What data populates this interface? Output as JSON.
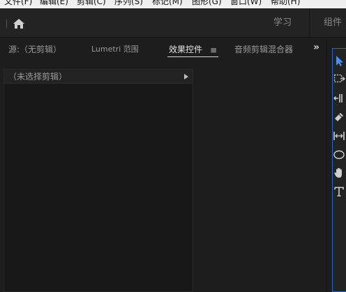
{
  "menu": {
    "items": [
      "文件(F)",
      "编辑(E)",
      "剪辑(C)",
      "序列(S)",
      "标记(M)",
      "图形(G)",
      "窗口(W)",
      "帮助(H)"
    ]
  },
  "header": {
    "home_icon": "home-icon",
    "workspaces": {
      "learn": "学习",
      "assembly": "组件"
    }
  },
  "panels": {
    "tabs": [
      {
        "label": "源:（无剪辑）",
        "active": false
      },
      {
        "label": "Lumetri 范围",
        "active": false
      },
      {
        "label": "效果控件",
        "active": true
      },
      {
        "label": "音频剪辑混合器",
        "active": false
      }
    ],
    "tab_menu_glyph": "≡",
    "overflow_glyph": "»"
  },
  "effect_controls": {
    "header_text": "（未选择剪辑）"
  },
  "tools": [
    {
      "name": "selection-tool-icon",
      "active": true
    },
    {
      "name": "track-select-tool-icon",
      "active": false
    },
    {
      "name": "ripple-edit-tool-icon",
      "active": false
    },
    {
      "name": "razor-tool-icon",
      "active": false
    },
    {
      "name": "slip-tool-icon",
      "active": false
    },
    {
      "name": "ellipse-tool-icon",
      "active": false
    },
    {
      "name": "hand-tool-icon",
      "active": false
    },
    {
      "name": "type-tool-icon",
      "active": false
    }
  ],
  "colors": {
    "accent": "#2f65b8",
    "background": "#1d1d1d",
    "header": "#232323"
  }
}
